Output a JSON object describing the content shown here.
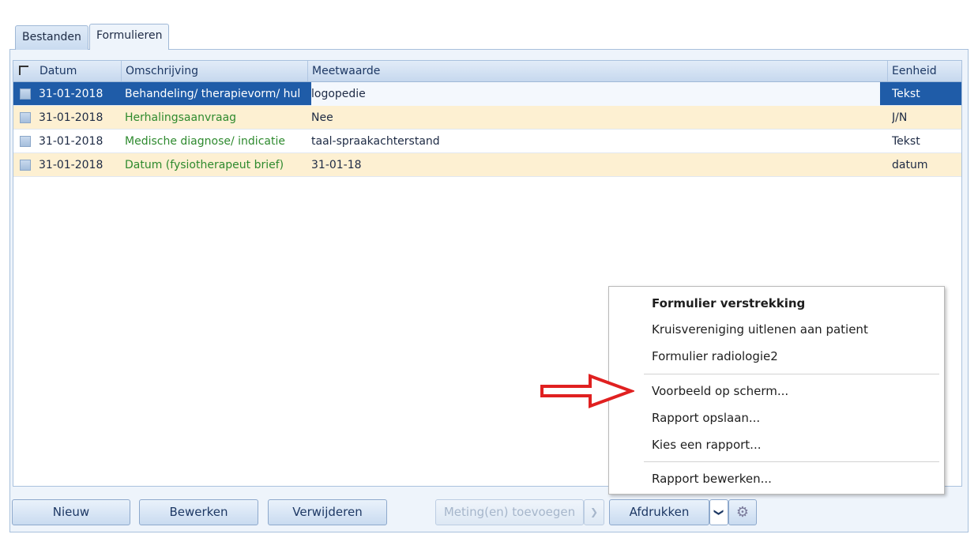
{
  "tabs": {
    "files": "Bestanden",
    "forms": "Formulieren"
  },
  "grid": {
    "headers": {
      "datum": "Datum",
      "omschrijving": "Omschrijving",
      "meetwaarde": "Meetwaarde",
      "eenheid": "Eenheid"
    },
    "rows": [
      {
        "datum": "31-01-2018",
        "omschrijving": "Behandeling/ therapievorm/ hul",
        "meetwaarde": "logopedie",
        "eenheid": "Tekst",
        "selected": true
      },
      {
        "datum": "31-01-2018",
        "omschrijving": "Herhalingsaanvraag",
        "meetwaarde": "Nee",
        "eenheid": "J/N"
      },
      {
        "datum": "31-01-2018",
        "omschrijving": "Medische diagnose/ indicatie",
        "meetwaarde": "taal-spraakachterstand",
        "eenheid": "Tekst"
      },
      {
        "datum": "31-01-2018",
        "omschrijving": "Datum (fysiotherapeut brief)",
        "meetwaarde": "31-01-18",
        "eenheid": "datum"
      }
    ]
  },
  "buttons": {
    "new": "Nieuw",
    "edit": "Bewerken",
    "delete": "Verwijderen",
    "add_measurement": "Meting(en) toevoegen",
    "print": "Afdrukken"
  },
  "menu": {
    "items": [
      "Formulier verstrekking",
      "Kruisvereniging uitlenen aan patient",
      "Formulier radiologie2",
      "Voorbeeld op scherm...",
      "Rapport opslaan...",
      "Kies een rapport...",
      "Rapport bewerken..."
    ]
  },
  "colors": {
    "selected_row": "#1f5ca8",
    "alt_row": "#fdf0d2",
    "description_text": "#2e8a2e",
    "arrow": "#e02020"
  }
}
